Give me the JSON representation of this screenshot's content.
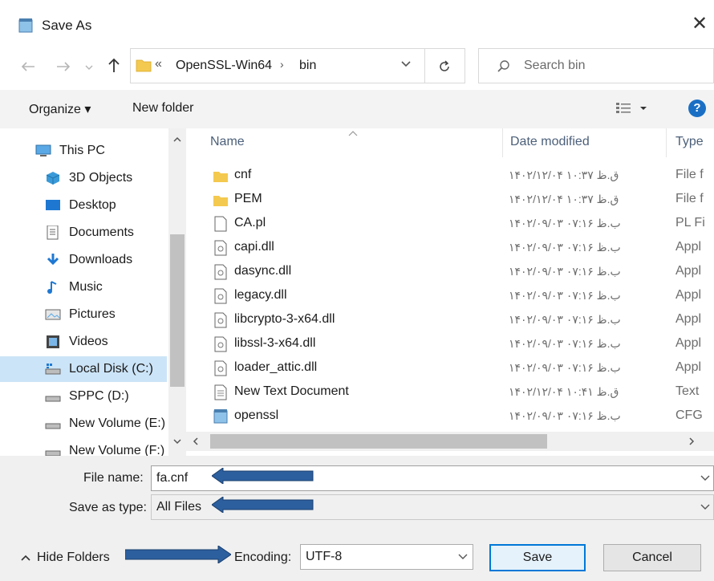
{
  "window": {
    "title": "Save As",
    "close_glyph": "✕"
  },
  "address": {
    "overflow_glyph": "«",
    "crumbs": [
      "OpenSSL-Win64",
      "bin"
    ],
    "separator": "›"
  },
  "search": {
    "placeholder": "Search bin"
  },
  "toolbar": {
    "organize_label": "Organize ▾",
    "new_folder_label": "New folder",
    "help_glyph": "?"
  },
  "sidebar": {
    "items": [
      {
        "label": "This PC",
        "icon": "computer-icon"
      },
      {
        "label": "3D Objects",
        "icon": "cube-icon"
      },
      {
        "label": "Desktop",
        "icon": "desktop-icon"
      },
      {
        "label": "Documents",
        "icon": "documents-icon"
      },
      {
        "label": "Downloads",
        "icon": "download-icon"
      },
      {
        "label": "Music",
        "icon": "music-icon"
      },
      {
        "label": "Pictures",
        "icon": "pictures-icon"
      },
      {
        "label": "Videos",
        "icon": "videos-icon"
      },
      {
        "label": "Local Disk (C:)",
        "icon": "drive-icon"
      },
      {
        "label": "SPPC (D:)",
        "icon": "drive-icon"
      },
      {
        "label": "New Volume (E:)",
        "icon": "drive-icon"
      },
      {
        "label": "New Volume (F:)",
        "icon": "drive-icon"
      }
    ],
    "selected_index": 8
  },
  "filelist": {
    "columns": [
      "Name",
      "Date modified",
      "Type"
    ],
    "rows": [
      {
        "name": "cnf",
        "date": "۱۴۰۲/۱۲/۰۴ ق.ظ ۱۰:۳۷",
        "type": "File f",
        "icon": "folder-icon"
      },
      {
        "name": "PEM",
        "date": "۱۴۰۲/۱۲/۰۴ ق.ظ ۱۰:۳۷",
        "type": "File f",
        "icon": "folder-icon"
      },
      {
        "name": "CA.pl",
        "date": "۱۴۰۲/۰۹/۰۳ ب.ظ ۰۷:۱۶",
        "type": "PL Fi",
        "icon": "file-icon"
      },
      {
        "name": "capi.dll",
        "date": "۱۴۰۲/۰۹/۰۳ ب.ظ ۰۷:۱۶",
        "type": "Appl",
        "icon": "dll-icon"
      },
      {
        "name": "dasync.dll",
        "date": "۱۴۰۲/۰۹/۰۳ ب.ظ ۰۷:۱۶",
        "type": "Appl",
        "icon": "dll-icon"
      },
      {
        "name": "legacy.dll",
        "date": "۱۴۰۲/۰۹/۰۳ ب.ظ ۰۷:۱۶",
        "type": "Appl",
        "icon": "dll-icon"
      },
      {
        "name": "libcrypto-3-x64.dll",
        "date": "۱۴۰۲/۰۹/۰۳ ب.ظ ۰۷:۱۶",
        "type": "Appl",
        "icon": "dll-icon"
      },
      {
        "name": "libssl-3-x64.dll",
        "date": "۱۴۰۲/۰۹/۰۳ ب.ظ ۰۷:۱۶",
        "type": "Appl",
        "icon": "dll-icon"
      },
      {
        "name": "loader_attic.dll",
        "date": "۱۴۰۲/۰۹/۰۳ ب.ظ ۰۷:۱۶",
        "type": "Appl",
        "icon": "dll-icon"
      },
      {
        "name": "New Text Document",
        "date": "۱۴۰۲/۱۲/۰۴ ق.ظ ۱۰:۴۱",
        "type": "Text",
        "icon": "text-file-icon"
      },
      {
        "name": "openssl",
        "date": "۱۴۰۲/۰۹/۰۳ ب.ظ ۰۷:۱۶",
        "type": "CFG",
        "icon": "config-file-icon"
      }
    ]
  },
  "form": {
    "file_name_label": "File name:",
    "file_name_value": "fa.cnf",
    "save_type_label": "Save as type:",
    "save_type_value": "All Files",
    "encoding_label": "Encoding:",
    "encoding_value": "UTF-8",
    "save_label": "Save",
    "cancel_label": "Cancel",
    "hide_folders_label": "Hide Folders"
  },
  "colors": {
    "accent": "#0078d7",
    "selected_bg": "#cce4f7",
    "annotation_arrow": "#2c5f9e",
    "folder": "#f4c94f"
  }
}
